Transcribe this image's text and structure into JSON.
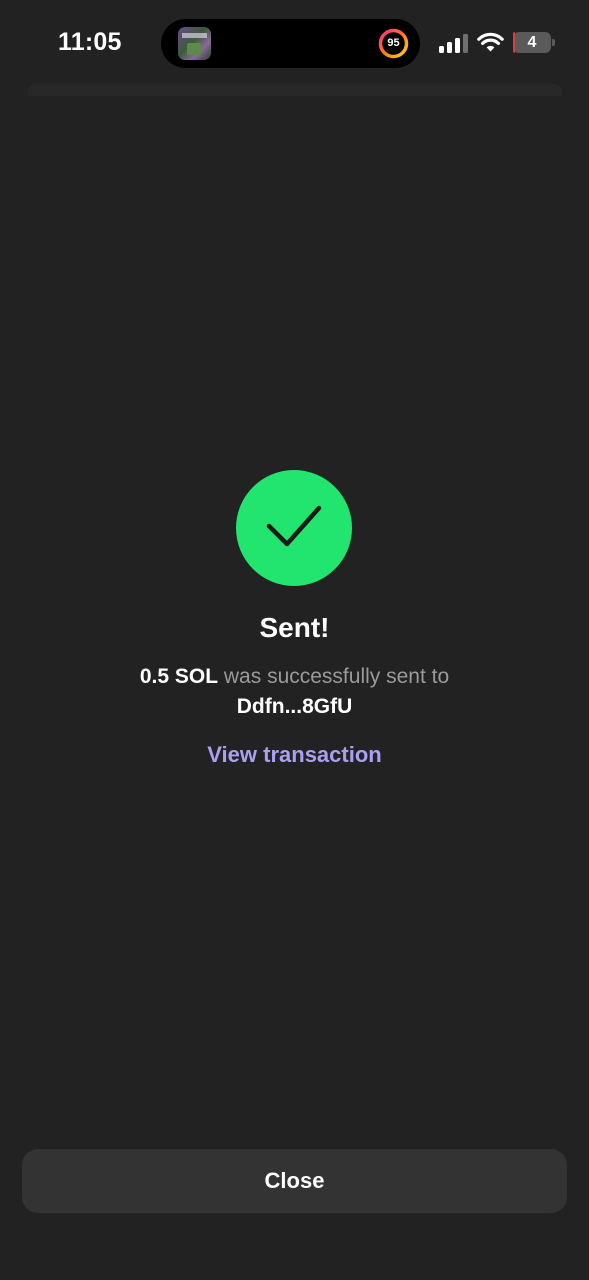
{
  "status_bar": {
    "time": "11:05",
    "activity_ring_value": "95",
    "battery_level": "4",
    "battery_fraction": 0.04,
    "signal_bars_active": 3,
    "signal_bars_total": 4
  },
  "result": {
    "icon": "checkmark-icon",
    "title": "Sent!",
    "amount": "0.5 SOL",
    "message_middle": "was successfully sent to",
    "recipient": "Ddfn...8GfU",
    "link_label": "View transaction"
  },
  "footer": {
    "close_label": "Close"
  },
  "colors": {
    "background": "#222222",
    "success": "#21e56f",
    "link": "#ab9ff2",
    "button": "#333333",
    "muted_text": "#9a9a9a"
  }
}
